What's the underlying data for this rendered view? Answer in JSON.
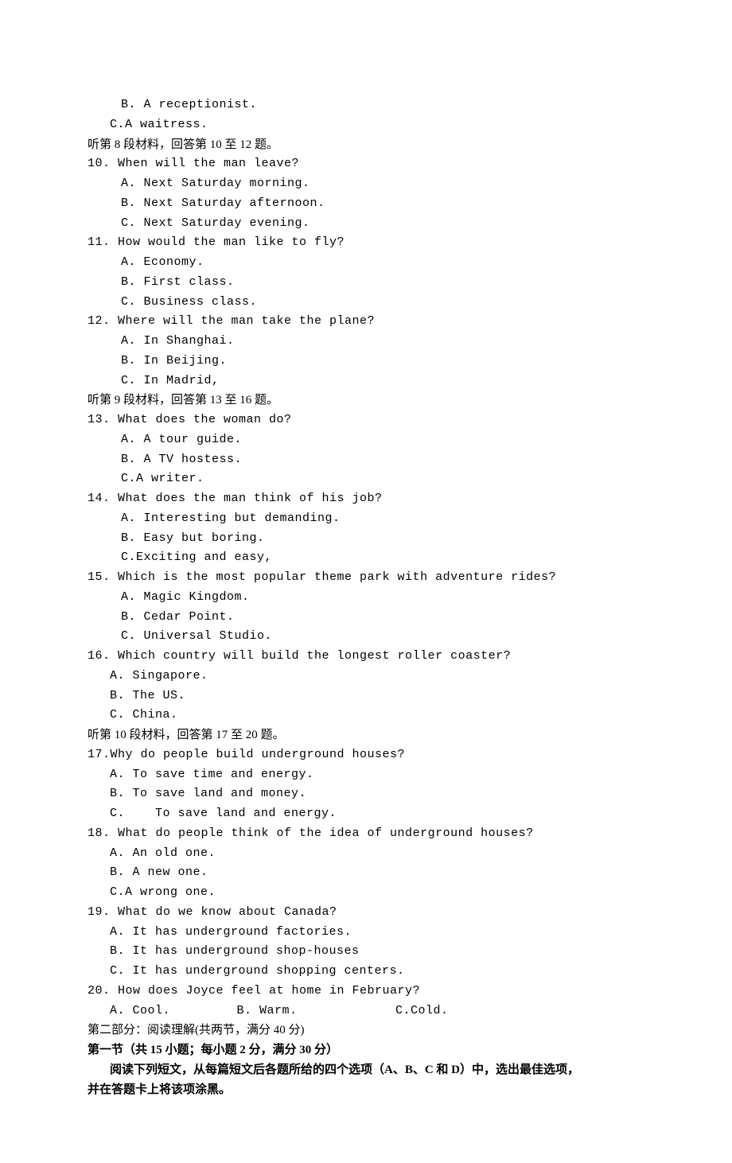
{
  "prior": {
    "optB": "B. A receptionist.",
    "optC": "C.A waitress."
  },
  "passage8_intro": "听第 8 段材料，回答第 10 至 12 题。",
  "q10": {
    "stem": "10. When will the man leave?",
    "a": "A. Next Saturday morning.",
    "b": "B. Next Saturday afternoon.",
    "c": "C. Next Saturday evening."
  },
  "q11": {
    "stem": "11. How would the man like to fly?",
    "a": "A. Economy.",
    "b": "B. First class.",
    "c": "C. Business class."
  },
  "q12": {
    "stem": "12. Where will the man take the plane?",
    "a": "A. In Shanghai.",
    "b": "B. In Beijing.",
    "c": "C. In Madrid,"
  },
  "passage9_intro": "听第 9 段材料，回答第 13 至 16 题。",
  "q13": {
    "stem": "13. What does the woman do?",
    "a": "A. A tour guide.",
    "b": "B. A TV hostess.",
    "c": "C.A writer."
  },
  "q14": {
    "stem": "14. What does the man think of his job?",
    "a": "A. Interesting but demanding.",
    "b": "B. Easy but boring.",
    "c": "C.Exciting and easy,"
  },
  "q15": {
    "stem": "15. Which is the most popular theme park with adventure rides?",
    "a": "A. Magic Kingdom.",
    "b": "B. Cedar Point.",
    "c": "C. Universal Studio."
  },
  "q16": {
    "stem": "16. Which country will build the longest roller coaster?",
    "a": "A. Singapore.",
    "b": "B. The US.",
    "c": "C. China."
  },
  "passage10_intro": "听第 10 段材料，回答第 17 至 20 题。",
  "q17": {
    "stem": "17.Why do people build underground houses?",
    "a": "A. To save time and energy.",
    "b": "B. To save land and money.",
    "c": "C.    To save land and energy."
  },
  "q18": {
    "stem": "18. What do people think of the idea of underground houses?",
    "a": "A. An old one.",
    "b": "B. A new one.",
    "c": "C.A wrong one."
  },
  "q19": {
    "stem": "19. What do we know about Canada?",
    "a": "A. It has underground factories.",
    "b": "B. It has underground shop-houses",
    "c": "C. It has underground shopping centers."
  },
  "q20": {
    "stem": "20. How does Joyce feel at home in February?",
    "a": "A. Cool.",
    "b": "B. Warm.",
    "c": "C.Cold."
  },
  "part2_header": "第二部分：阅读理解(共两节，满分 40 分)",
  "part2_section1": "第一节（共 15 小题；每小题 2 分，满分 30 分）",
  "part2_instruction1": "阅读下列短文，从每篇短文后各题所给的四个选项（A、B、C 和 D）中，选出最佳选项，",
  "part2_instruction2": "并在答题卡上将该项涂黑。"
}
